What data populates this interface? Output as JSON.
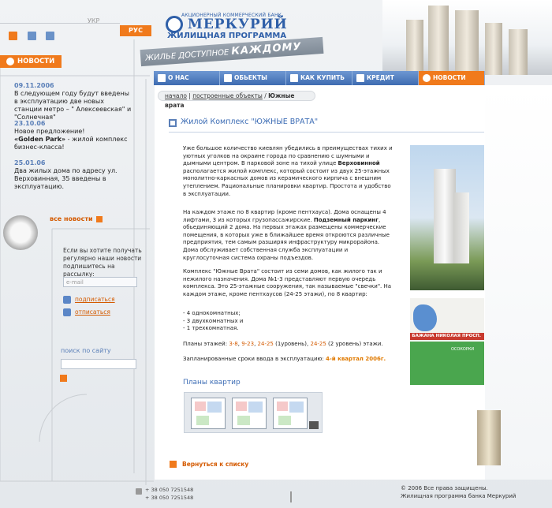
{
  "lang": {
    "ukr": "УКР",
    "rus": "РУС"
  },
  "bank": {
    "small": "АКЦИОНЕРНЫЙ КОММЕРЧЕСКИЙ БАНК",
    "name": "МЕРКУРИЙ",
    "program": "ЖИЛИЩНАЯ ПРОГРАММА"
  },
  "slogan": {
    "a": "ЖИЛЬЕ ДОСТУПНОЕ",
    "b": "КАЖДОМУ"
  },
  "nav": [
    {
      "label": "О НАС"
    },
    {
      "label": "ОБЬЕКТЫ"
    },
    {
      "label": "КАК КУПИТЬ"
    },
    {
      "label": "КРЕДИТ"
    },
    {
      "label": "НОВОСТИ"
    }
  ],
  "sidebar": {
    "news_title": "НОВОСТИ",
    "news": [
      {
        "date": "09.11.2006",
        "text": "В следующем году будут введены в эксплуатацию две новых станции метро – \" Алексеевская\" и \"Солнечная\""
      },
      {
        "date": "23.10.06",
        "text_a": "Новое предложение!",
        "text_bold": "«Golden Park»",
        "text_b": " - жилой комплекс бизнес-класса!"
      },
      {
        "date": "25.01.06",
        "text": "Два жилых дома по адресу ул. Верховинная, 35 введены в эксплуатацию."
      }
    ],
    "all_news": "все новости",
    "subscribe_text": "Если вы хотите получать регулярно наши новости подпишитесь на рассылку:",
    "email_placeholder": "e-mail",
    "subscribe": "подписаться",
    "unsubscribe": "отписаться",
    "search_title": "поиск по сайту"
  },
  "breadcrumb": {
    "home": "начало",
    "objects": "построенные объекты",
    "current": "Южные врата"
  },
  "title": "Жилой Комплекс \"ЮЖНЫЕ ВРАТА\"",
  "content": {
    "p1_a": "Уже большое количество киевлян убедились в преимуществах тихих и уютных уголков на окраине города по сравнению с шумными и дымными центром. В парковой зоне на тихой улице ",
    "p1_b": "Верховинной",
    "p1_c": " располагается жилой комплекс, который  состоит из двух 25-этажных  монолитно-каркасных домов из керамического кирпича с внешним утеплением. Рациональные планировки квартир. Простота и удобство в эксплуатации.",
    "p2_a": "На каждом этаже по 8 квартир (кроме пентхауса). Дома оснащены 4 лифтами, 3 из которых грузопассажирские. ",
    "p2_b": "Подземный паркинг",
    "p2_c": ", обьединяющий 2 дома. На первых этажах размещены коммерческие помещения, в которых уже в ближайшее время откроются различные предприятия, тем самым разширяя инфраструктуру микрорайона. Дома обслуживает собственная служба эксплуатации и круглосуточная система охраны подъездов.",
    "p3": "Комплекс \"Южные Врата\" состоит из семи домов, как жилого так и нежилого назначения. Дома №1-3 представляют первую очередь комплекса. Это 25-этажные сооружения, так называемые \"свечки\". На каждом этаже, кроме пентхаусов (24-25 этажи), по 8 квартир:",
    "li1": "- 4 однокомнатных;",
    "li2": "- 3 двухкомнатных и",
    "li3": "- 1 трехкомнатная.",
    "floors_a": "Планы этажей: ",
    "floors_l1": "3-8",
    "floors_l2": "9-23",
    "floors_l3": "24-25",
    "floors_b": " (1уровень), ",
    "floors_l4": "24-25",
    "floors_c": " (2 уровень) этажи.",
    "deadline_a": "Запланированные сроки ввода в эксплуатацию: ",
    "deadline_b": "4-й квартал 2006г."
  },
  "map": {
    "street": "БАЖАНА НИКОЛАЯ ПРОСП.",
    "metro": "ОСОКОРКИ"
  },
  "plans_title": "Планы квартир",
  "back": "Вернуться к списку",
  "phones": {
    "p1": "+ 38 050 7251548",
    "p2": "+ 38 050 7251548"
  },
  "footer": {
    "l1": "© 2006 Все права защищены.",
    "l2": "Жилищная программа банка Меркурий"
  },
  "colors": {
    "accent": "#f07a1c",
    "blue": "#3d6db5"
  }
}
